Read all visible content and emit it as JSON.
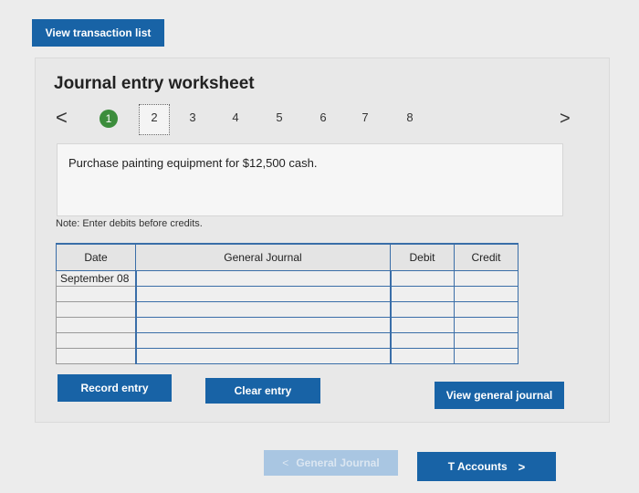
{
  "top_button": {
    "label": "View transaction list"
  },
  "worksheet": {
    "title": "Journal entry worksheet",
    "nav": {
      "prev": "<",
      "next": ">"
    },
    "steps": [
      "1",
      "2",
      "3",
      "4",
      "5",
      "6",
      "7",
      "8"
    ],
    "active_step": "1",
    "description": "Purchase painting equipment for $12,500 cash.",
    "note": "Note: Enter debits before credits.",
    "table": {
      "headers": {
        "date": "Date",
        "general_journal": "General Journal",
        "debit": "Debit",
        "credit": "Credit"
      },
      "rows": [
        {
          "date": "September 08",
          "account": "",
          "debit": "",
          "credit": ""
        },
        {
          "date": "",
          "account": "",
          "debit": "",
          "credit": ""
        },
        {
          "date": "",
          "account": "",
          "debit": "",
          "credit": ""
        },
        {
          "date": "",
          "account": "",
          "debit": "",
          "credit": ""
        },
        {
          "date": "",
          "account": "",
          "debit": "",
          "credit": ""
        },
        {
          "date": "",
          "account": "",
          "debit": "",
          "credit": ""
        }
      ]
    },
    "buttons": {
      "record": "Record entry",
      "clear": "Clear entry",
      "view_general_journal": "View general journal"
    }
  },
  "bottom_nav": {
    "general_journal": "General Journal",
    "t_accounts": "T Accounts"
  },
  "colors": {
    "primary": "#1863a6",
    "step_active": "#3c8d3c",
    "disabled": "#a9c6e2"
  }
}
